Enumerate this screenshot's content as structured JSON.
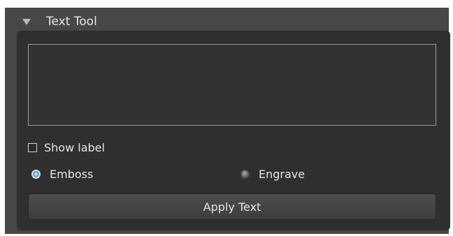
{
  "panel": {
    "title": "Text Tool",
    "collapse_icon": "triangle-down-icon"
  },
  "text_input": {
    "value": "",
    "placeholder": ""
  },
  "show_label": {
    "label": "Show label",
    "checked": false
  },
  "mode": {
    "options": [
      {
        "label": "Emboss",
        "selected": true
      },
      {
        "label": "Engrave",
        "selected": false
      }
    ]
  },
  "apply_button": {
    "label": "Apply Text"
  },
  "colors": {
    "panel_background": "#474747",
    "content_background": "#2f2f2f",
    "text": "#e6e6e6",
    "radio_accent": "#3a9fe2"
  }
}
